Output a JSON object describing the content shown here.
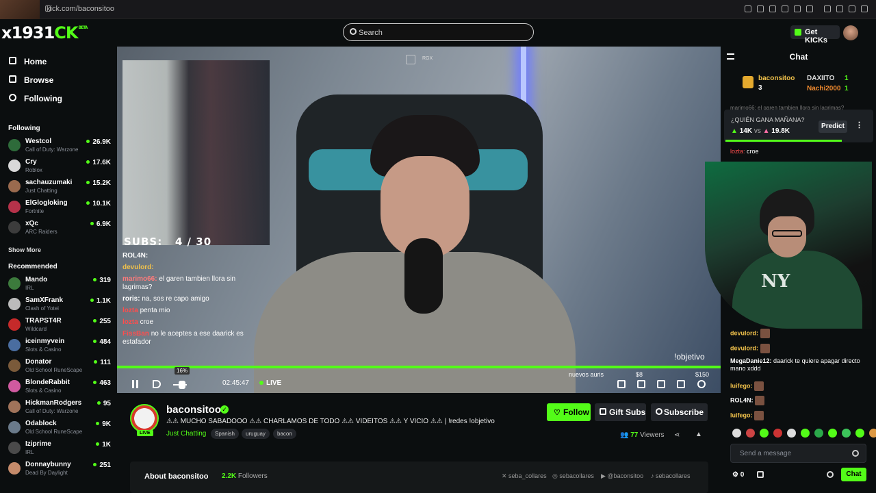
{
  "browser": {
    "url": "kick.com/baconsitoo"
  },
  "logo": {
    "prefix": "x1931",
    "accent": "CK",
    "beta": "BETA"
  },
  "header": {
    "search_placeholder": "Search",
    "get_kicks": "Get KICKs"
  },
  "nav": {
    "home": "Home",
    "browse": "Browse",
    "following": "Following"
  },
  "following": {
    "title": "Following",
    "items": [
      {
        "name": "Westcol",
        "category": "Call of Duty: Warzone",
        "viewers": "26.9K"
      },
      {
        "name": "Cry",
        "category": "Roblox",
        "viewers": "17.6K"
      },
      {
        "name": "sachauzumaki",
        "category": "Just Chatting",
        "viewers": "15.2K"
      },
      {
        "name": "ElGlogloking",
        "category": "Fortnite",
        "viewers": "10.1K"
      },
      {
        "name": "xQc",
        "category": "ARC Raiders",
        "viewers": "6.9K"
      }
    ],
    "show_more": "Show More"
  },
  "recommended": {
    "title": "Recommended",
    "items": [
      {
        "name": "Mando",
        "category": "IRL",
        "viewers": "319"
      },
      {
        "name": "SamXFrank",
        "category": "Clash of Yotei",
        "viewers": "1.1K"
      },
      {
        "name": "TRAPST4R",
        "category": "Wildcard",
        "viewers": "255"
      },
      {
        "name": "iceinmyvein",
        "category": "Slots & Casino",
        "viewers": "484"
      },
      {
        "name": "Donator",
        "category": "Old School RuneScape",
        "viewers": "111"
      },
      {
        "name": "BlondeRabbit",
        "category": "Slots & Casino",
        "viewers": "463"
      },
      {
        "name": "HickmanRodgers",
        "category": "Call of Duty: Warzone",
        "viewers": "95"
      },
      {
        "name": "Odablock",
        "category": "Old School RuneScape",
        "viewers": "9K"
      },
      {
        "name": "Iziprime",
        "category": "IRL",
        "viewers": "1K"
      },
      {
        "name": "Donnaybunny",
        "category": "Dead By Daylight",
        "viewers": "251"
      }
    ]
  },
  "player": {
    "subs_label": "SUBS:",
    "subs_value": "4 / 30",
    "top_tag": "RGX",
    "objetivo": "!objetivo",
    "goal_label": "nuevos auris",
    "goal_mid": "$8",
    "goal_max": "$150",
    "volume_tip": "16%",
    "time": "02:45:47",
    "live": "LIVE",
    "overlay_chat": [
      {
        "user": "ROL4N:",
        "text": "",
        "color": "#ffffff"
      },
      {
        "user": "devulord:",
        "text": "",
        "color": "#f0c14b"
      },
      {
        "user": "marimo66:",
        "text": "el garen tambien llora sin lagrimas?",
        "color": "#ff7b7b"
      },
      {
        "user": "roris:",
        "text": "na, sos re capo amigo",
        "color": "#ffffff"
      },
      {
        "user": "lozta",
        "text": "penta mio",
        "color": "#ff4d4d"
      },
      {
        "user": "lozta",
        "text": "croe",
        "color": "#ff4d4d"
      },
      {
        "user": "FissBan",
        "text": "no le aceptes a ese daarick es estafador",
        "color": "#ff4d4d"
      }
    ]
  },
  "stream": {
    "channel": "baconsitoo",
    "title": "⚠⚠ MUCHO SABADOOO ⚠⚠ CHARLAMOS DE TODO ⚠⚠ VIDEITOS ⚠⚠ Y VICIO ⚠⚠ | !redes !objetivo",
    "category": "Just Chatting",
    "tags": [
      "Spanish",
      "uruguay",
      "bacon"
    ],
    "live_badge": "LIVE",
    "follow": "Follow",
    "gift_subs": "Gift Subs",
    "subscribe": "Subscribe",
    "viewers_count": "77",
    "viewers_label": "Viewers",
    "about_label": "About baconsitoo",
    "followers_count": "2.2K",
    "followers_label": "Followers",
    "socials": [
      "seba_collares",
      "sebacollares",
      "@baconsitoo",
      "sebacollares"
    ]
  },
  "chat": {
    "title": "Chat",
    "leaderboard": [
      {
        "name": "baconsitoo",
        "count": "3"
      },
      {
        "name": "DAXIITO",
        "count": "1"
      },
      {
        "name": "Nachi2000",
        "count": "1"
      }
    ],
    "faded_message": "marimo66: el garen tambien llora sin lagrimas?",
    "prediction": {
      "question": "¿QUIÉN GANA MAÑANA?",
      "option_a": "14K",
      "vs": "vs",
      "option_b": "19.8K",
      "button": "Predict"
    },
    "pinned": {
      "user": "lozta:",
      "text": "croe"
    },
    "messages": [
      {
        "user": "devulord:",
        "text": ""
      },
      {
        "user": "devulord:",
        "text": ""
      },
      {
        "user": "MegaDanie12:",
        "text": "daarick te quiere apagar directo mano xddd"
      },
      {
        "user": "luifego:",
        "text": ""
      },
      {
        "user": "ROL4N:",
        "text": ""
      },
      {
        "user": "luifego:",
        "text": ""
      }
    ],
    "input_placeholder": "Send a message",
    "points": "0",
    "send": "Chat"
  },
  "colors": {
    "accent": "#53fc18",
    "bg": "#0b0e0f",
    "panel": "#23262b"
  }
}
